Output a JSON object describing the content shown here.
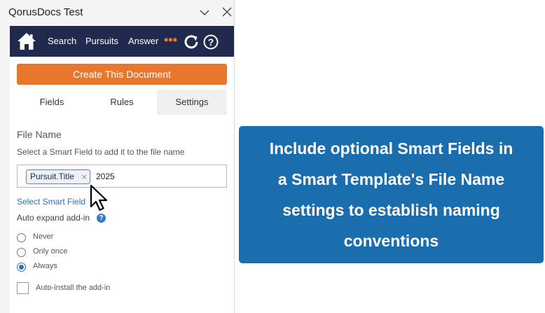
{
  "pane": {
    "title": "QorusDocs Test",
    "chevron_icon": "chevron-down-icon",
    "close_icon": "close-icon"
  },
  "navbar": {
    "home_icon": "home-icon",
    "links": [
      "Search",
      "Pursuits",
      "Answer"
    ],
    "more_label": "•••",
    "refresh_icon": "refresh-icon",
    "help_icon": "help-icon",
    "colors": {
      "background": "#1f2a4e",
      "accent": "#e8762d"
    }
  },
  "create_button": {
    "label": "Create This Document",
    "color": "#e8762d"
  },
  "tabs": [
    {
      "label": "Fields",
      "active": false
    },
    {
      "label": "Rules",
      "active": false
    },
    {
      "label": "Settings",
      "active": true
    }
  ],
  "file_name": {
    "title": "File Name",
    "help_text": "Select a Smart Field to add it to the file name",
    "chip_label": "Pursuit.Title",
    "chip_remove": "×",
    "trailing_text": "2025",
    "select_link": "Select Smart Field"
  },
  "auto_expand": {
    "label": "Auto expand add-in",
    "help_glyph": "?",
    "options": [
      {
        "label": "Never",
        "checked": false
      },
      {
        "label": "Only once",
        "checked": false
      },
      {
        "label": "Always",
        "checked": true
      }
    ]
  },
  "auto_install": {
    "label": "Auto-install the add-in",
    "checked": false
  },
  "callout": {
    "lines": [
      "Include optional Smart Fields in",
      "a Smart Template's File Name",
      "settings to establish naming",
      "conventions"
    ],
    "color": "#1b6ead"
  }
}
